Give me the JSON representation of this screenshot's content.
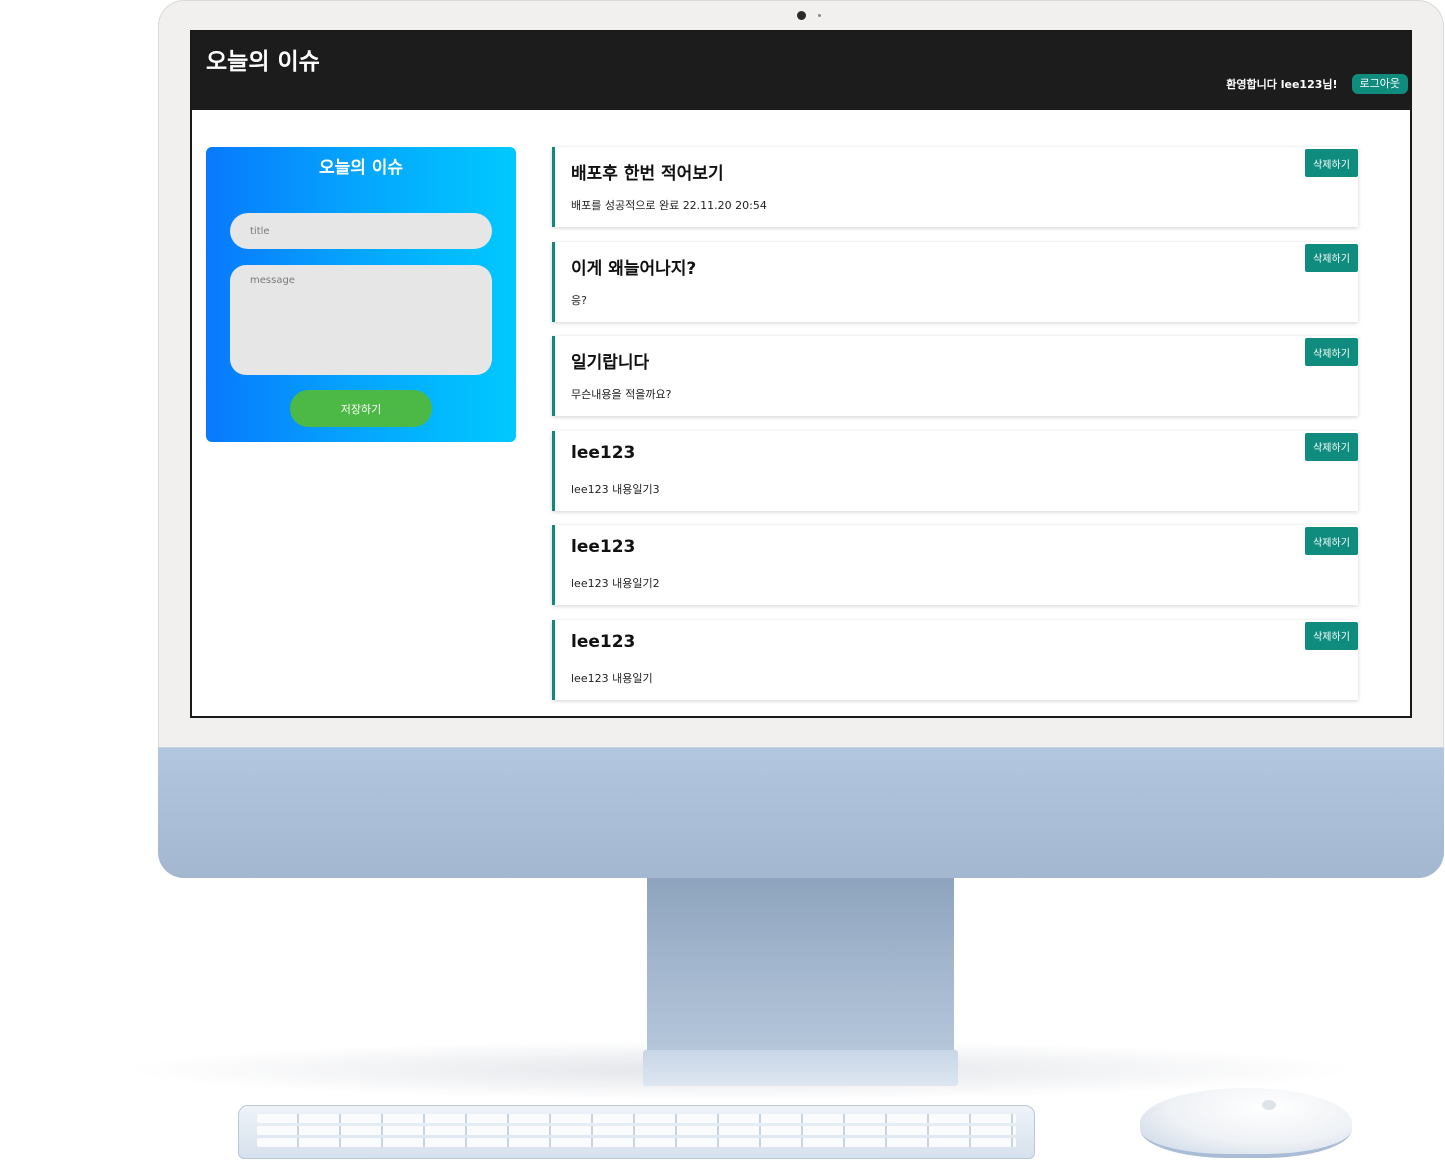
{
  "header": {
    "title": "오늘의 이슈",
    "welcome": "환영합니다 lee123님!",
    "logout_label": "로그아웃"
  },
  "form": {
    "title": "오늘의 이슈",
    "title_placeholder": "title",
    "message_placeholder": "message",
    "save_label": "저장하기"
  },
  "posts": [
    {
      "title": "배포후 한번 적어보기",
      "message": "배포를 성공적으로 완료 22.11.20 20:54",
      "delete_label": "삭제하기"
    },
    {
      "title": "이게 왜늘어나지?",
      "message": "응?",
      "delete_label": "삭제하기"
    },
    {
      "title": "일기랍니다",
      "message": "무슨내용을 적을까요?",
      "delete_label": "삭제하기"
    },
    {
      "title": "lee123",
      "message": "lee123 내용일기3",
      "delete_label": "삭제하기"
    },
    {
      "title": "lee123",
      "message": "lee123 내용일기2",
      "delete_label": "삭제하기"
    },
    {
      "title": "lee123",
      "message": "lee123 내용일기",
      "delete_label": "삭제하기"
    }
  ],
  "colors": {
    "header_bg": "#1c1c1c",
    "accent_teal": "#0f8c7e",
    "save_green": "#4cb947",
    "panel_gradient_start": "#0879fd",
    "panel_gradient_end": "#00c9fe"
  }
}
